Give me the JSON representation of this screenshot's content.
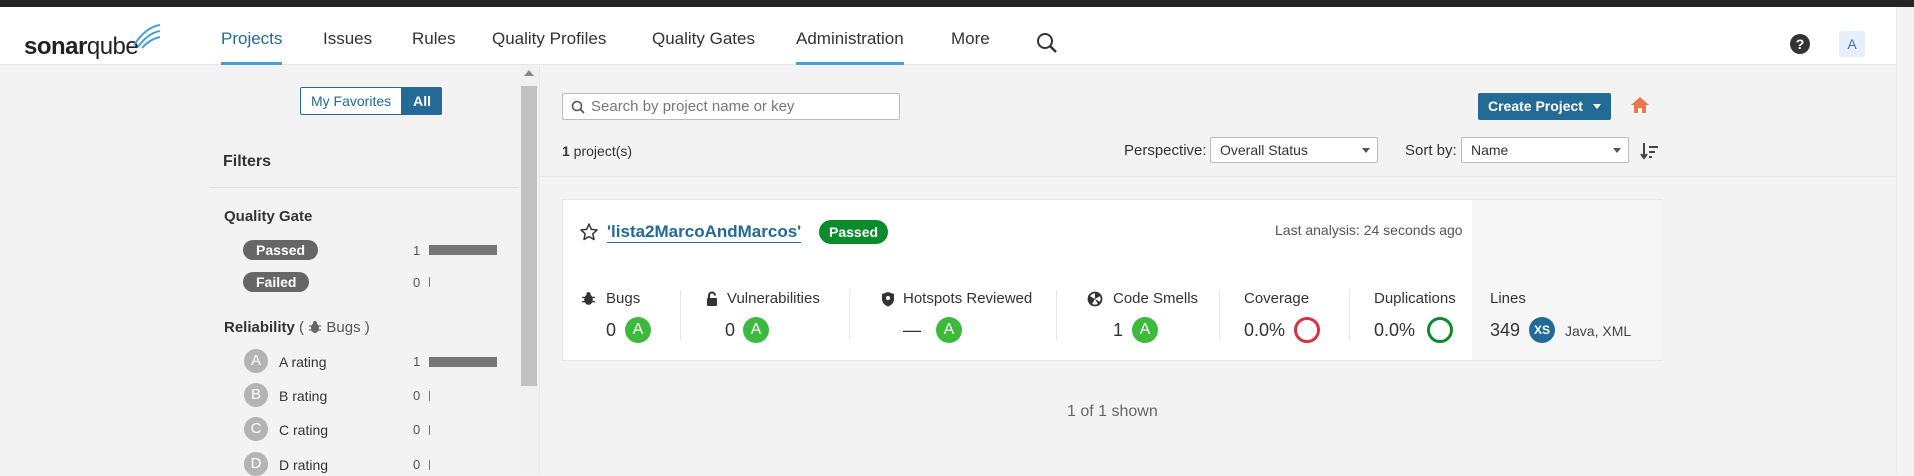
{
  "app": {
    "logo_text_1": "sonar",
    "logo_text_2": "qube"
  },
  "nav": {
    "items": [
      "Projects",
      "Issues",
      "Rules",
      "Quality Profiles",
      "Quality Gates",
      "Administration",
      "More"
    ],
    "avatar_letter": "A",
    "help_label": "?"
  },
  "sidebar": {
    "toggle_favorites": "My Favorites",
    "toggle_all": "All",
    "filters_title": "Filters",
    "quality_gate": {
      "title": "Quality Gate",
      "options": [
        {
          "label": "Passed",
          "count": "1"
        },
        {
          "label": "Failed",
          "count": "0"
        }
      ]
    },
    "reliability": {
      "title": "Reliability",
      "subtitle": "Bugs",
      "ratings": [
        {
          "letter": "A",
          "label": "A rating",
          "count": "1"
        },
        {
          "letter": "B",
          "label": "B rating",
          "count": "0"
        },
        {
          "letter": "C",
          "label": "C rating",
          "count": "0"
        },
        {
          "letter": "D",
          "label": "D rating",
          "count": "0"
        }
      ]
    }
  },
  "main": {
    "search_placeholder": "Search by project name or key",
    "create_button": "Create Project",
    "project_count": "1",
    "project_count_suffix": " project(s)",
    "perspective_label": "Perspective:",
    "perspective_value": "Overall Status",
    "sort_label": "Sort by:",
    "sort_value": "Name",
    "shown_text": "1 of 1 shown"
  },
  "project": {
    "name": "'lista2MarcoAndMarcos'",
    "quality_gate": "Passed",
    "last_analysis": "Last analysis: 24 seconds ago",
    "metrics": {
      "bugs_label": "Bugs",
      "bugs_value": "0",
      "bugs_grade": "A",
      "vuln_label": "Vulnerabilities",
      "vuln_value": "0",
      "vuln_grade": "A",
      "hotspots_label": "Hotspots Reviewed",
      "hotspots_value": "—",
      "hotspots_grade": "A",
      "smells_label": "Code Smells",
      "smells_value": "1",
      "smells_grade": "A",
      "coverage_label": "Coverage",
      "coverage_value": "0.0%",
      "dup_label": "Duplications",
      "dup_value": "0.0%",
      "lines_label": "Lines",
      "lines_value": "349",
      "size": "XS",
      "languages": "Java, XML"
    }
  },
  "colors": {
    "accent": "#236a97",
    "passed": "#0a8b2c",
    "grade_a": "#3dba3d",
    "coverage_bad": "#d4333f",
    "home": "#e9784c"
  }
}
